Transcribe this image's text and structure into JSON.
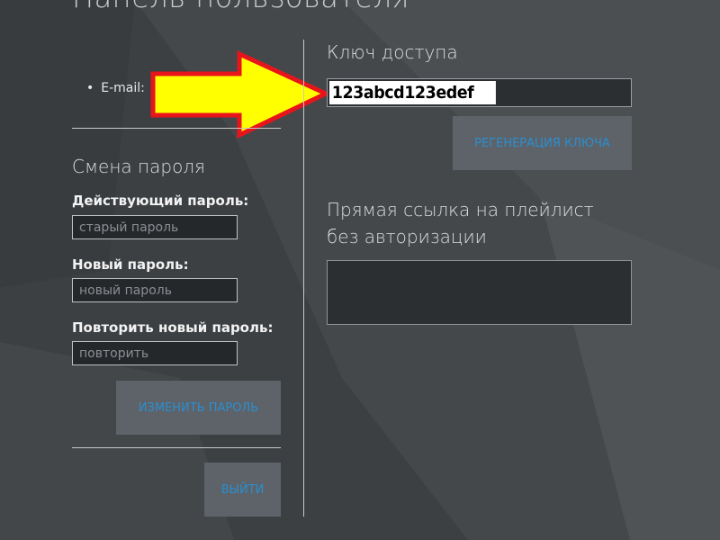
{
  "page": {
    "title": "Панель пользователя"
  },
  "account": {
    "email_label": "E-mail:"
  },
  "password_change": {
    "heading": "Смена пароля",
    "current_label": "Действующий пароль:",
    "current_placeholder": "старый пароль",
    "new_label": "Новый пароль:",
    "new_placeholder": "новый пароль",
    "repeat_label": "Повторить новый пароль:",
    "repeat_placeholder": "повторить",
    "submit_label": "изменить пароль"
  },
  "logout": {
    "label": "выйти"
  },
  "access_key": {
    "heading": "Ключ доступа",
    "value": "123abcd123edef",
    "regenerate_label": "регенерация ключа"
  },
  "playlist_link": {
    "heading_line1": "Прямая ссылка на плейлист",
    "heading_line2": "без авторизации"
  },
  "colors": {
    "button_bg": "#5d6369",
    "button_text": "#2b8ecf",
    "arrow_fill": "#ffff00",
    "arrow_stroke": "#e8141c"
  },
  "icons": {
    "callout_arrow": "arrow-right-icon"
  }
}
